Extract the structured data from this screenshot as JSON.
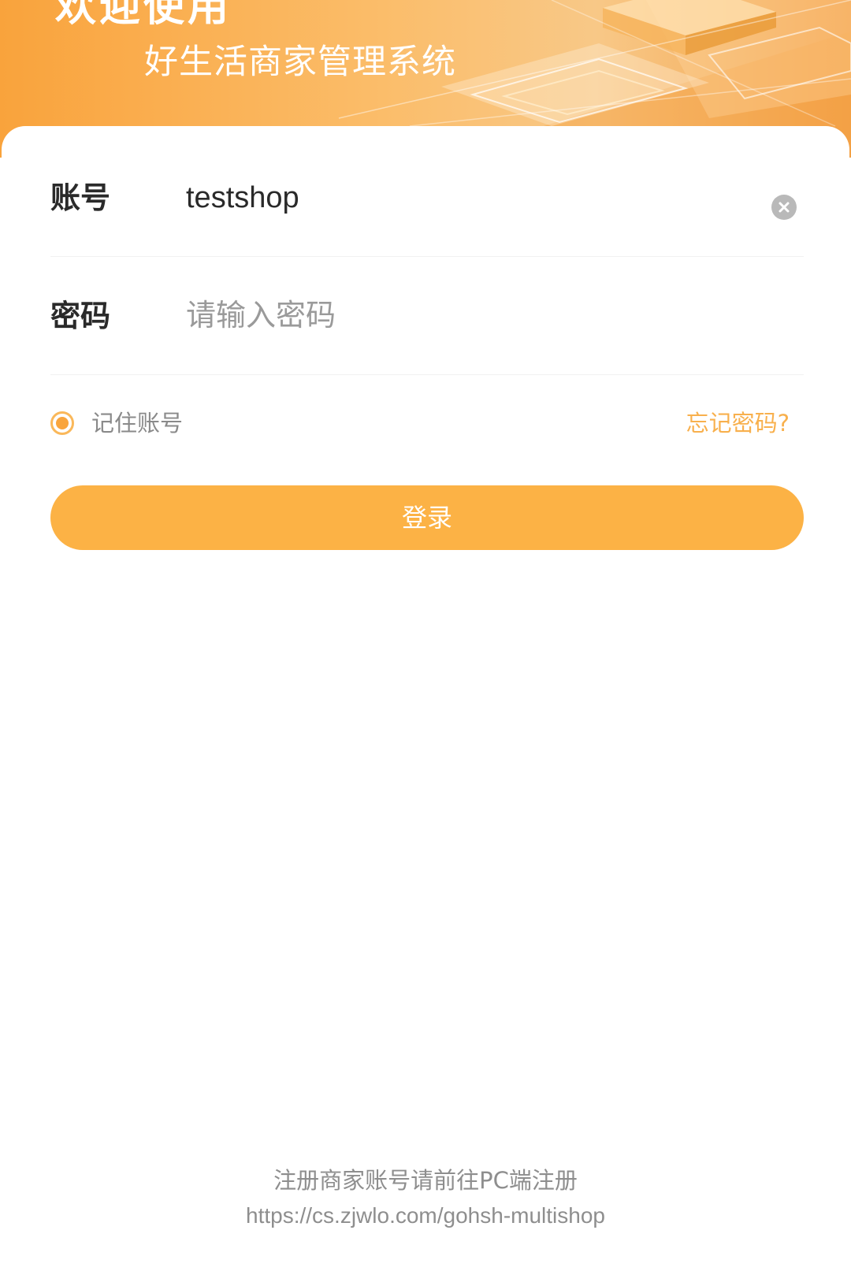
{
  "header": {
    "title": "欢迎使用",
    "subtitle": "好生活商家管理系统"
  },
  "form": {
    "account": {
      "label": "账号",
      "value": "testshop",
      "clear_icon": "clear-circle-icon"
    },
    "password": {
      "label": "密码",
      "placeholder": "请输入密码",
      "value": ""
    },
    "remember": {
      "label": "记住账号",
      "checked": true
    },
    "forgot_label": "忘记密码?",
    "login_label": "登录"
  },
  "footer": {
    "note": "注册商家账号请前往PC端注册",
    "url": "https://cs.zjwlo.com/gohsh-multishop"
  },
  "colors": {
    "accent": "#fcb245",
    "link": "#f8b04d"
  }
}
